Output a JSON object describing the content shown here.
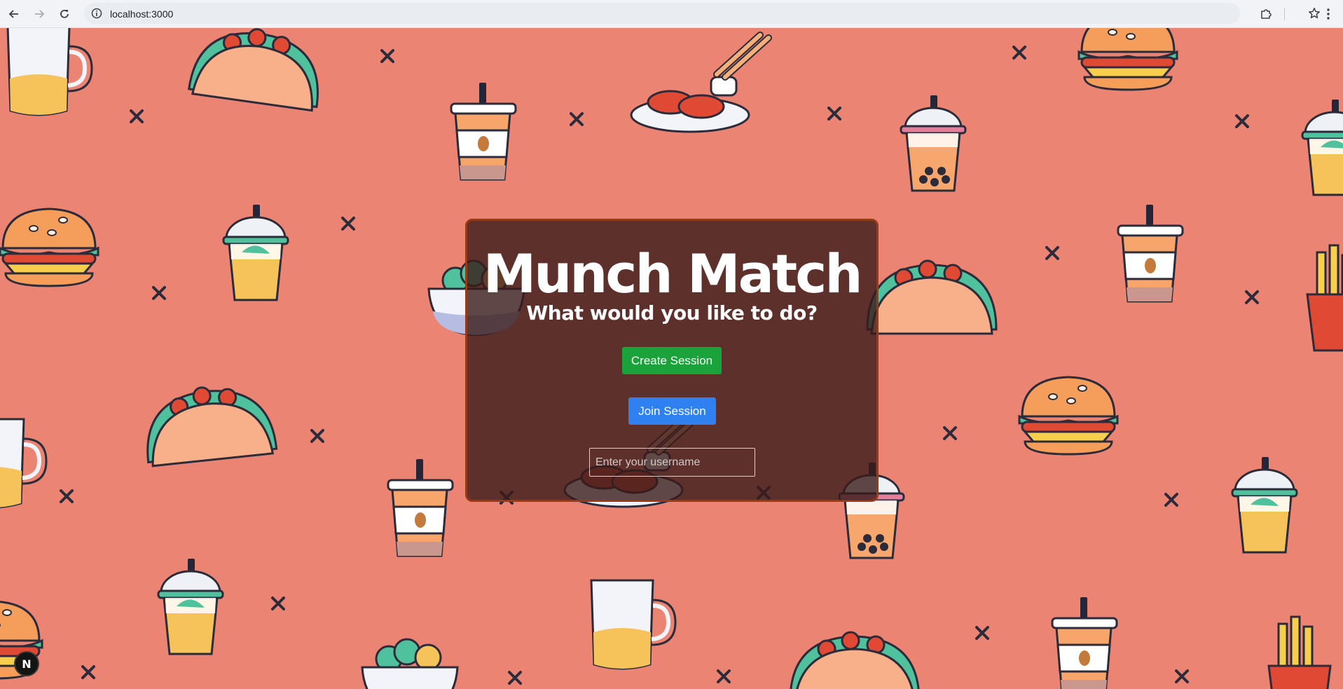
{
  "browser": {
    "url": "localhost:3000",
    "back_icon": "arrow-left-icon",
    "forward_icon": "arrow-right-icon",
    "reload_icon": "reload-icon",
    "info_icon": "info-icon",
    "bookmark_icon": "star-icon",
    "extensions_icon": "puzzle-icon",
    "menu_icon": "kebab-menu-icon"
  },
  "app": {
    "title": "Munch Match",
    "subtitle": "What would you like to do?",
    "create_label": "Create Session",
    "join_label": "Join Session",
    "username_placeholder": "Enter your username",
    "username_value": "",
    "dev_badge": "N"
  },
  "colors": {
    "background": "#ec8474",
    "card": "#3a1c1a",
    "card_border": "#9a3a14",
    "create_button": "#1aa33a",
    "join_button": "#2f80f0"
  }
}
